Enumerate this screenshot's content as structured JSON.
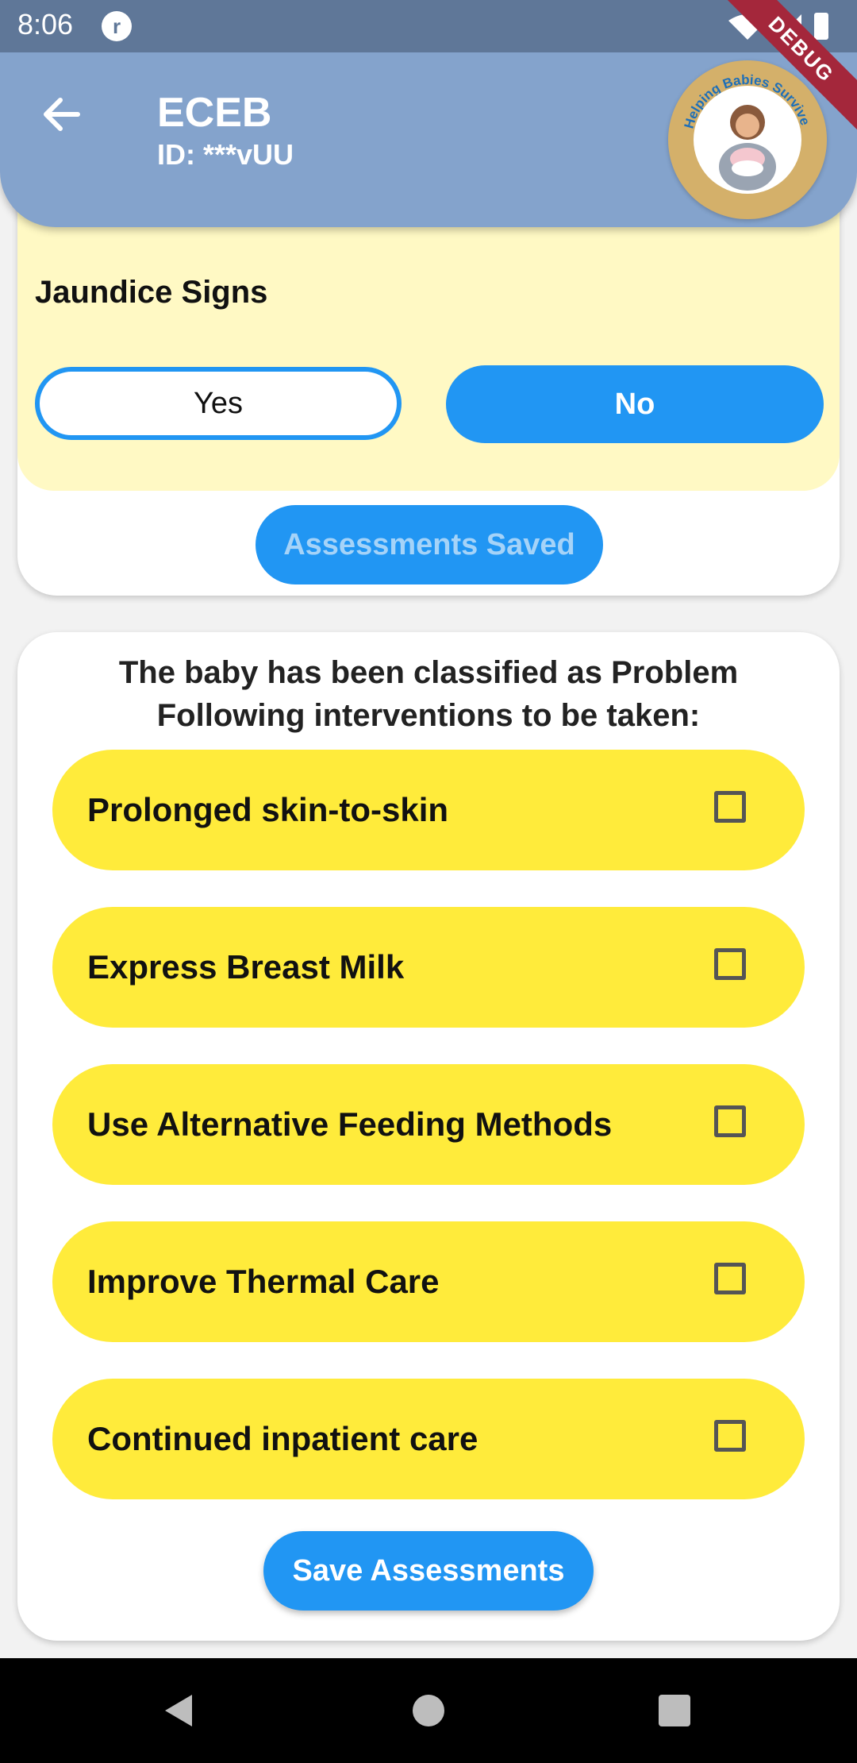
{
  "status_bar": {
    "time": "8:06",
    "app_icon_glyph": "r",
    "icons": [
      "wifi-icon",
      "signal-icon",
      "battery-icon"
    ]
  },
  "app_bar": {
    "title": "ECEB",
    "subtitle": "ID: ***vUU",
    "logo_text": "Helping Babies Survive",
    "debug_label": "DEBUG",
    "background_color": "#84a3cc"
  },
  "assessment": {
    "question": "Jaundice Signs",
    "options": [
      "Yes",
      "No"
    ],
    "selected": "No",
    "saved_button": "Assessments Saved",
    "panel_color": "#fff9c4"
  },
  "classification": {
    "line1": "The baby has been classified as Problem",
    "line2": "Following interventions to be taken:"
  },
  "interventions": [
    {
      "label": "Prolonged skin-to-skin",
      "checked": false
    },
    {
      "label": "Express Breast Milk",
      "checked": false
    },
    {
      "label": "Use Alternative Feeding Methods",
      "checked": false
    },
    {
      "label": "Improve Thermal Care",
      "checked": false
    },
    {
      "label": "Continued inpatient care",
      "checked": false
    }
  ],
  "save_button": "Save Assessments",
  "colors": {
    "accent": "#2196f3",
    "intervention_bg": "#ffeb3b",
    "status_bar": "#5f7798"
  }
}
